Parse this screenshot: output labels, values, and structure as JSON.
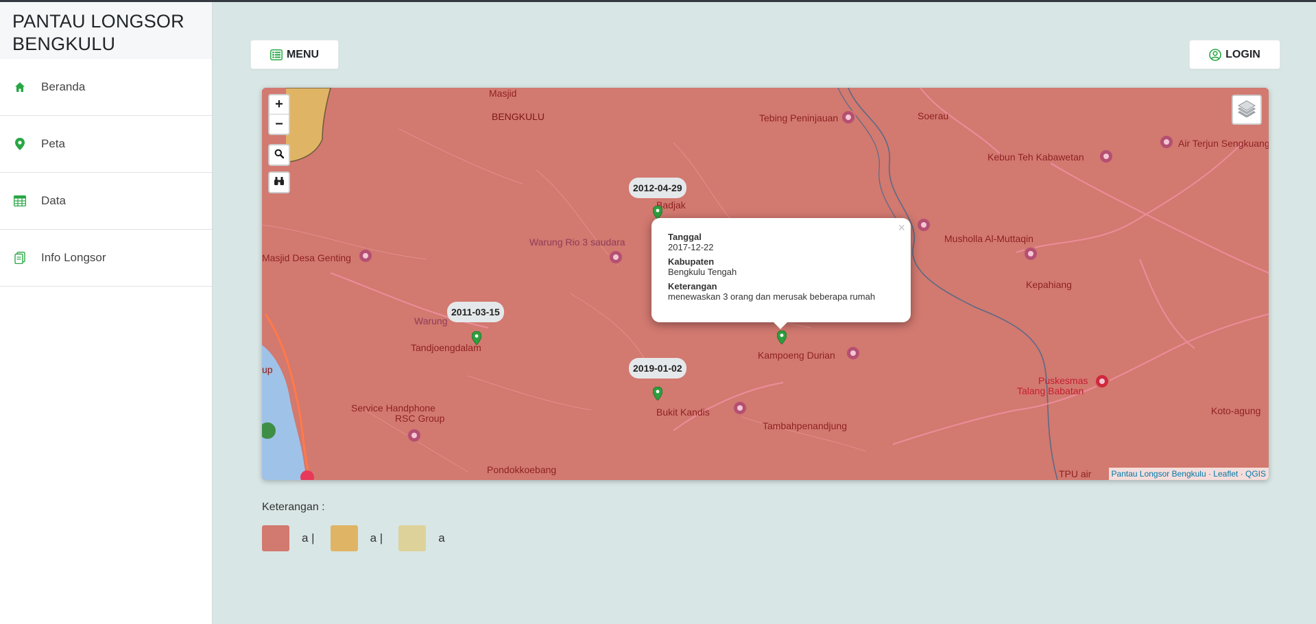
{
  "brand": "PANTAU LONGSOR BENGKULU",
  "sidebar": {
    "items": [
      {
        "label": "Beranda",
        "icon": "home-icon"
      },
      {
        "label": "Peta",
        "icon": "map-pin-icon"
      },
      {
        "label": "Data",
        "icon": "table-icon"
      },
      {
        "label": "Info Longsor",
        "icon": "document-icon"
      }
    ]
  },
  "header": {
    "menu_label": "MENU",
    "login_label": "LOGIN"
  },
  "map": {
    "zoom_in": "+",
    "zoom_out": "−",
    "places": {
      "bengkulu": "BENGKULU",
      "tebing": "Tebing Peninjauan",
      "soerau": "Soerau",
      "kebun_teh": "Kebun Teh Kabawetan",
      "air_terjun": "Air Terjun Sengkuang",
      "badjak": "Badjak",
      "warung_rio": "Warung Rio 3 saudara",
      "masjid_desa": "Masjid Desa Genting",
      "musholla": "Musholla Al-Muttaqin",
      "kepahiang": "Kepahiang",
      "warung": "Warung",
      "tandjoengdalam": "Tandjoengdalam",
      "kampoeng_durian": "Kampoeng Durian",
      "puskesmas": "Puskesmas",
      "talang_babatan": "Talang Babatan",
      "service_handphone": "Service Handphone",
      "rsc_group": "RSC Group",
      "bukit_kandis": "Bukit Kandis",
      "tambahpenandjung": "Tambahpenandjung",
      "koto_agung": "Koto-agung",
      "pondokkoebang": "Pondokkoebang",
      "tpu_air": "TPU air",
      "masjid": "Masjid",
      "up": "up"
    },
    "markers": [
      {
        "date": "2012-04-29"
      },
      {
        "date": "2011-03-15"
      },
      {
        "date": "2019-01-02"
      }
    ],
    "popup": {
      "k1": "Tanggal",
      "v1": "2017-12-22",
      "k2": "Kabupaten",
      "v2": "Bengkulu Tengah",
      "k3": "Keterangan",
      "v3": "menewaskan 3 orang dan merusak beberapa rumah",
      "close": "×"
    },
    "attribution": "Pantau Longsor Bengkulu · Leaflet · QGIS"
  },
  "legend": {
    "title": "Keterangan :",
    "items": [
      {
        "label": "a |",
        "color": "#d27970"
      },
      {
        "label": "a |",
        "color": "#e0b465"
      },
      {
        "label": "a",
        "color": "#ddd29a"
      }
    ]
  },
  "colors": {
    "accent": "#28a745",
    "background": "#d8e6e5",
    "map_red": "#d27970",
    "map_orange": "#e0b465"
  }
}
